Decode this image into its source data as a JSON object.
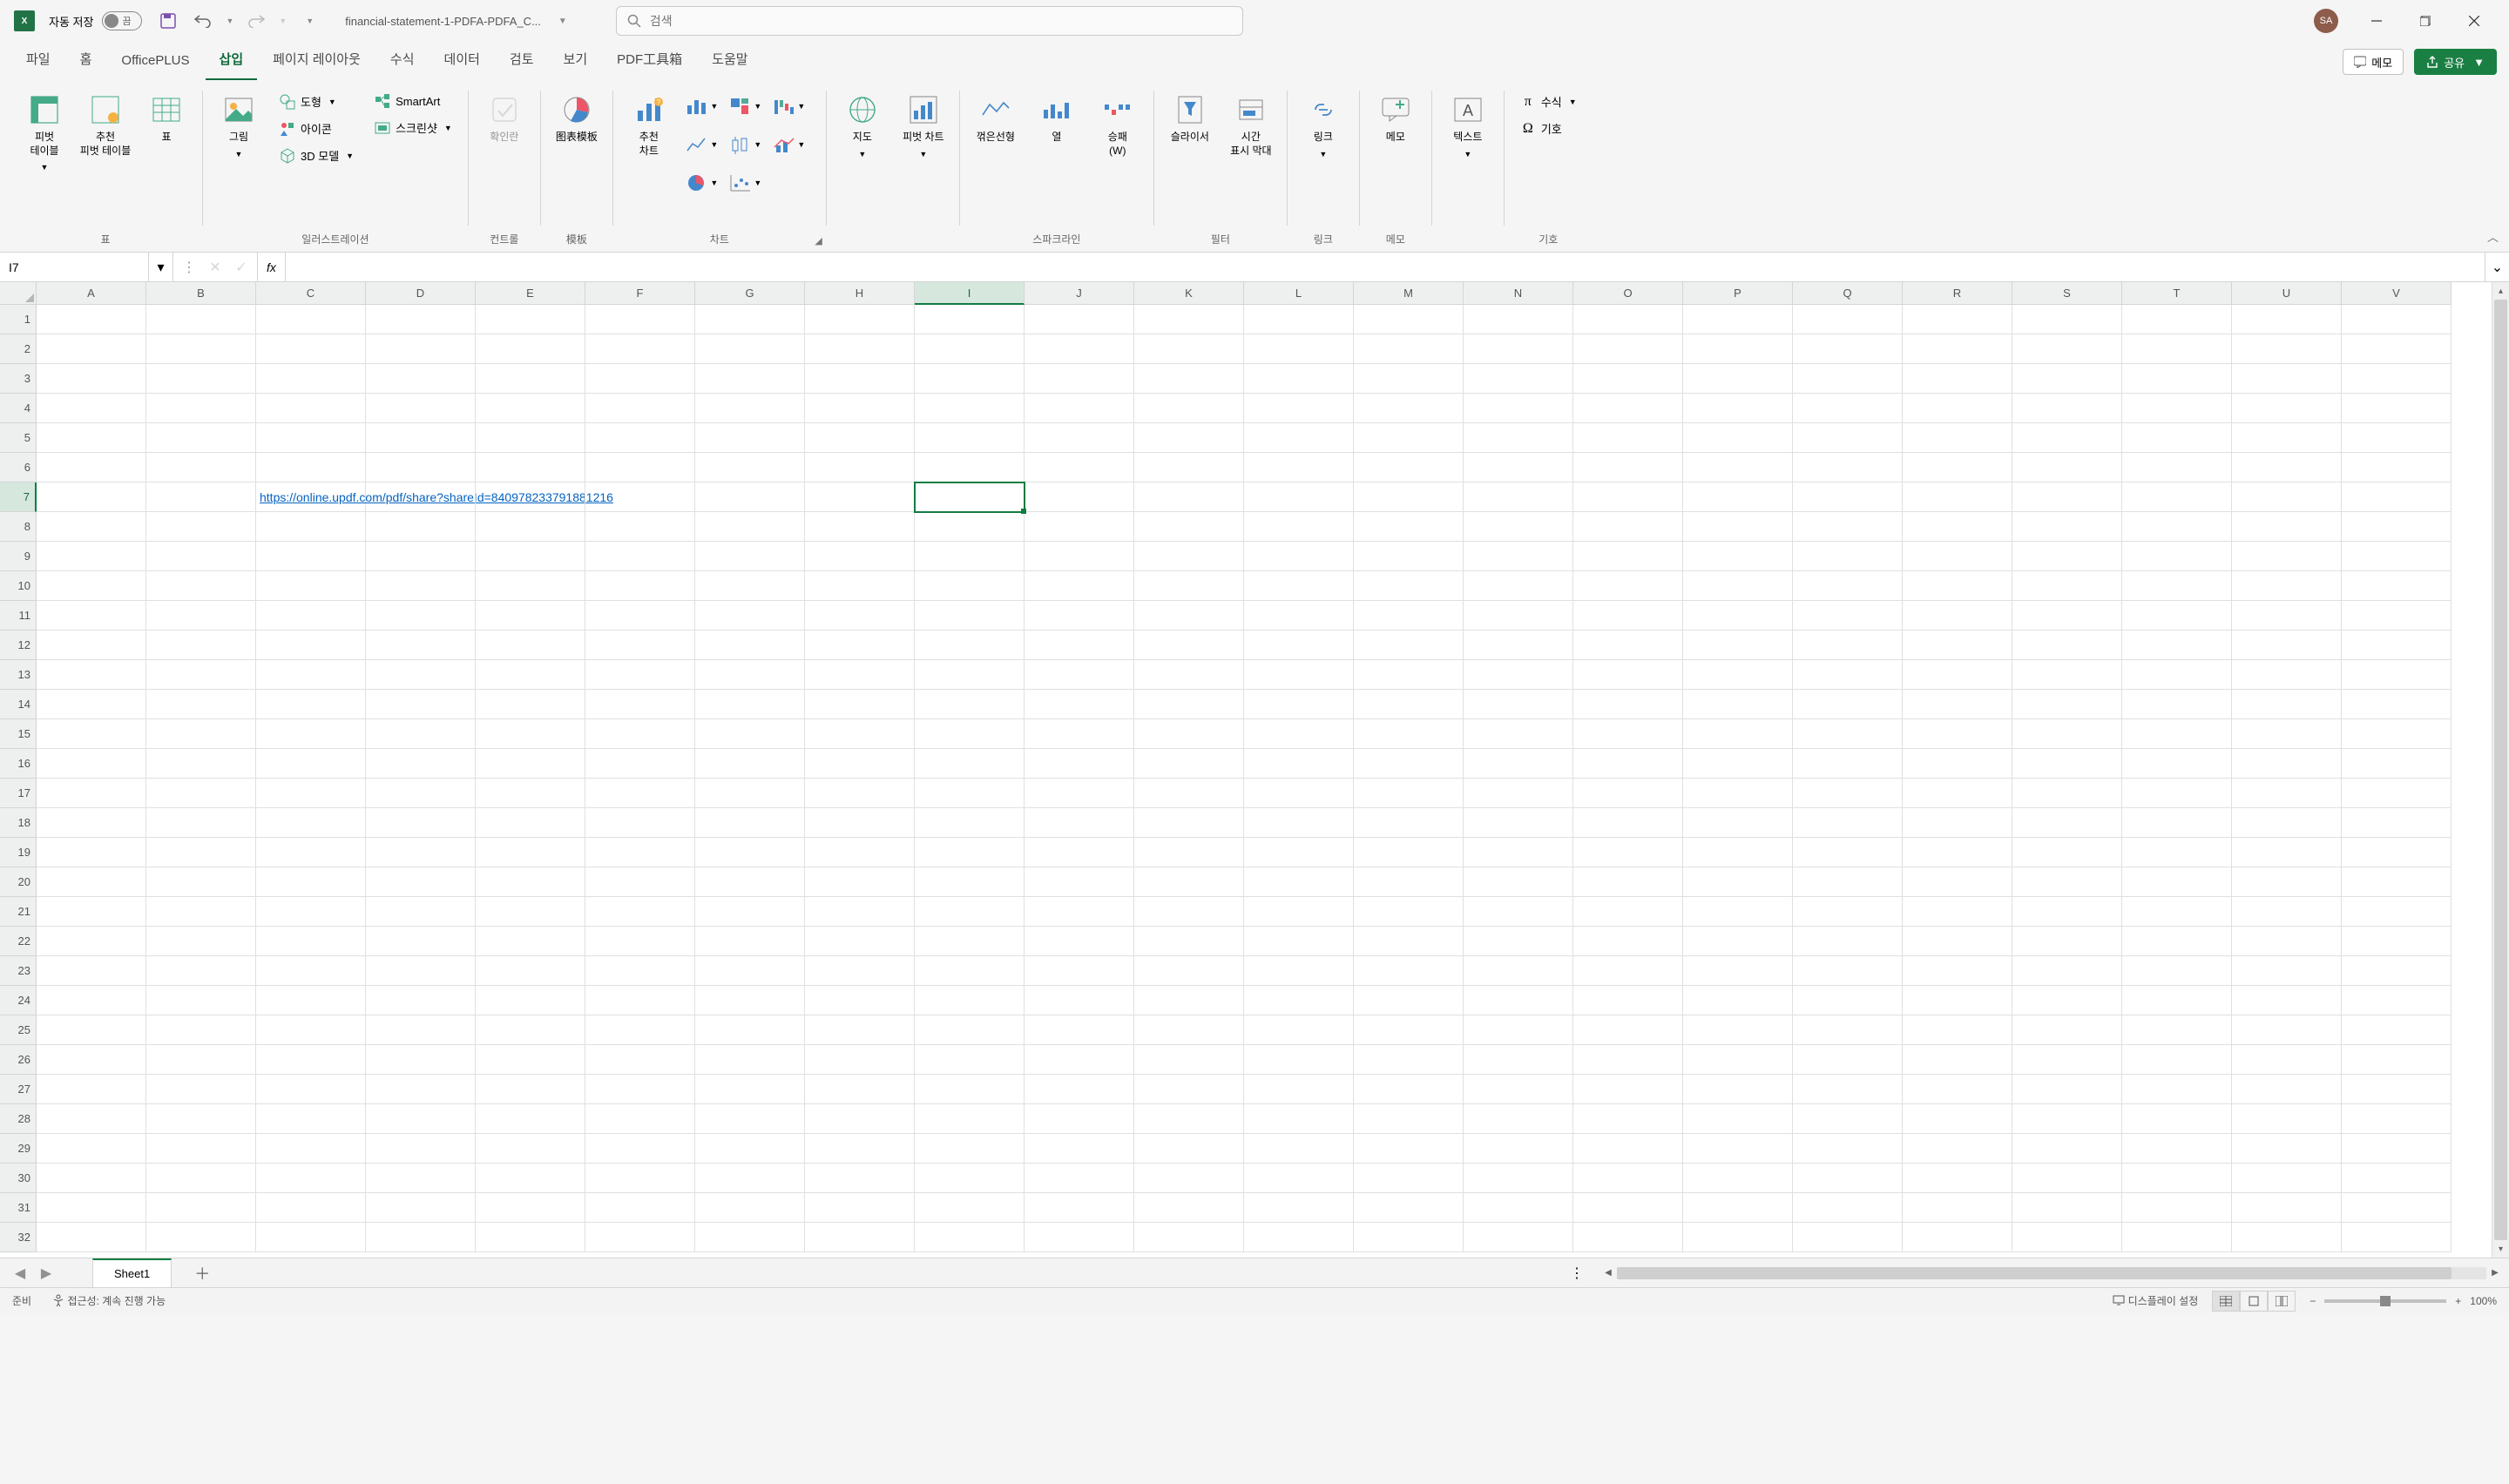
{
  "app": {
    "icon_letter": "X",
    "autosave_label": "자동 저장",
    "autosave_state": "끔",
    "file_title": "financial-statement-1-PDFA-PDFA_C..."
  },
  "qat": {
    "save": "",
    "undo": "",
    "redo": ""
  },
  "search": {
    "placeholder": "검색"
  },
  "user": {
    "initials": "SA"
  },
  "tabs": {
    "items": [
      {
        "label": "파일"
      },
      {
        "label": "홈"
      },
      {
        "label": "OfficePLUS"
      },
      {
        "label": "삽입"
      },
      {
        "label": "페이지 레이아웃"
      },
      {
        "label": "수식"
      },
      {
        "label": "데이터"
      },
      {
        "label": "검토"
      },
      {
        "label": "보기"
      },
      {
        "label": "PDF工具箱"
      },
      {
        "label": "도움말"
      }
    ],
    "active_index": 3,
    "memo_btn": "메모",
    "share_btn": "공유"
  },
  "ribbon": {
    "groups": {
      "tables": {
        "label": "표",
        "pivot": "피벗\n테이블",
        "recpivot": "추천\n피벗 테이블",
        "table": "표"
      },
      "illust": {
        "label": "일러스트레이션",
        "picture": "그림",
        "shapes": "도형",
        "icons": "아이콘",
        "smartart": "SmartArt",
        "screenshot": "스크린샷",
        "model3d": "3D 모델"
      },
      "addins": {
        "label": "컨트롤",
        "checkbox": "확인란"
      },
      "template": {
        "label": "模板",
        "chart_tpl": "图表模板"
      },
      "charts": {
        "label": "차트",
        "recchart": "추천\n차트"
      },
      "maps": {
        "label": "",
        "maps": "지도",
        "pivotchart": "피벗 차트"
      },
      "spark": {
        "label": "스파크라인",
        "line": "꺾은선형",
        "column": "열",
        "winloss": "승패\n(W)"
      },
      "filter": {
        "label": "필터",
        "slicer": "슬라이서",
        "timeline": "시간\n표시 막대"
      },
      "link": {
        "label": "링크",
        "link": "링크"
      },
      "memo": {
        "label": "메모",
        "memo": "메모"
      },
      "text": {
        "label": "",
        "text": "텍스트"
      },
      "symbol": {
        "label": "기호",
        "equation": "수식",
        "symbol": "기호"
      }
    }
  },
  "formula_bar": {
    "name_box": "I7",
    "fx": "fx",
    "formula": ""
  },
  "grid": {
    "columns": [
      "A",
      "B",
      "C",
      "D",
      "E",
      "F",
      "G",
      "H",
      "I",
      "J",
      "K",
      "L",
      "M",
      "N",
      "O",
      "P",
      "Q",
      "R",
      "S",
      "T",
      "U",
      "V"
    ],
    "row_count": 32,
    "active": {
      "col": "I",
      "row": 7
    },
    "cells": {
      "C7": {
        "text": "https://online.updf.com/pdf/share?shareId=840978233791881216",
        "hyperlink": true
      }
    }
  },
  "sheets": {
    "active": "Sheet1"
  },
  "status": {
    "ready": "준비",
    "accessibility": "접근성: 계속 진행 가능",
    "display": "디스플레이 설정",
    "zoom_pct": "100%"
  }
}
